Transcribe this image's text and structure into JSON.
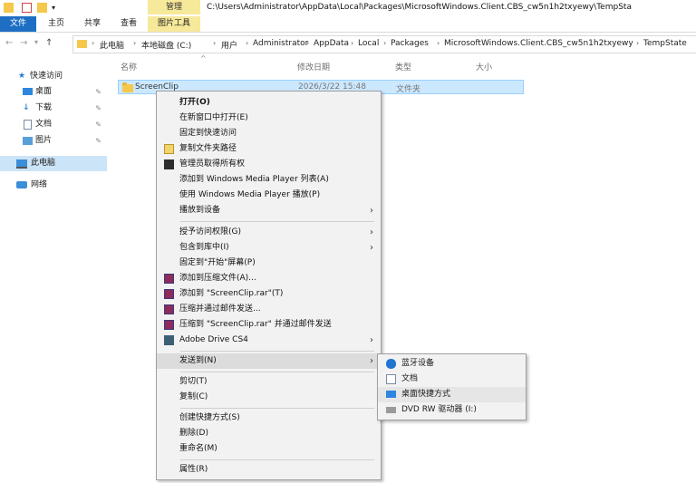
{
  "titlebar": {
    "contextual_tab": "管理",
    "path_title": "C:\\Users\\Administrator\\AppData\\Local\\Packages\\MicrosoftWindows.Client.CBS_cw5n1h2txyewy\\TempSta"
  },
  "ribbon": {
    "tabs": [
      "文件",
      "主页",
      "共享",
      "查看",
      "图片工具"
    ]
  },
  "breadcrumb": [
    "此电脑",
    "本地磁盘 (C:)",
    "用户",
    "Administrator",
    "AppData",
    "Local",
    "Packages",
    "MicrosoftWindows.Client.CBS_cw5n1h2txyewy",
    "TempState"
  ],
  "nav": {
    "quick_access": "快速访问",
    "items": [
      "桌面",
      "下载",
      "文档",
      "图片"
    ],
    "this_pc": "此电脑",
    "network": "网络"
  },
  "columns": [
    "名称",
    "修改日期",
    "类型",
    "大小"
  ],
  "file_row": {
    "name": "ScreenClip",
    "date": "2026/3/22 15:48",
    "type": "文件夹"
  },
  "context_menu": {
    "items": [
      "打开(O)",
      "在新窗口中打开(E)",
      "固定到快速访问",
      "复制文件夹路径",
      "管理员取得所有权",
      "添加到 Windows Media Player 列表(A)",
      "使用 Windows Media Player 播放(P)",
      "播放到设备",
      "授予访问权限(G)",
      "包含到库中(I)",
      "固定到\"开始\"屏幕(P)",
      "添加到压缩文件(A)...",
      "添加到 \"ScreenClip.rar\"(T)",
      "压缩并通过邮件发送...",
      "压缩到 \"ScreenClip.rar\" 并通过邮件发送",
      "Adobe Drive CS4",
      "发送到(N)",
      "剪切(T)",
      "复制(C)",
      "创建快捷方式(S)",
      "删除(D)",
      "重命名(M)",
      "属性(R)"
    ]
  },
  "send_to": {
    "items": [
      "蓝牙设备",
      "文档",
      "桌面快捷方式",
      "DVD RW 驱动器 (I:)"
    ]
  },
  "colors": {
    "accent": "#1e6fc4",
    "contextual": "#f7e99a",
    "selection": "#cce8ff",
    "menu_bg": "#f2f2f2"
  }
}
